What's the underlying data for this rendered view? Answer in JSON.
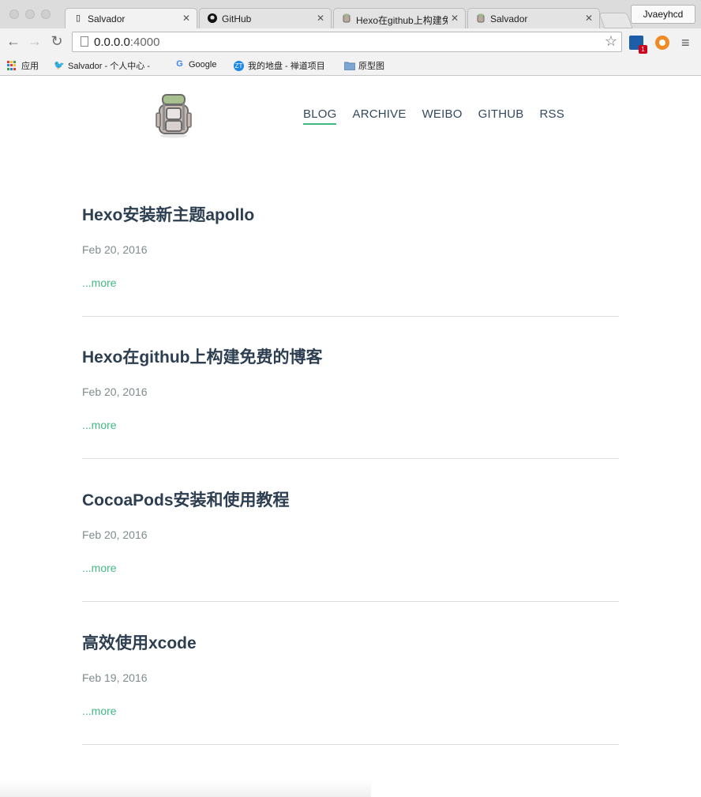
{
  "browser": {
    "tabs": [
      {
        "title": "Salvador",
        "icon": "page-icon",
        "active": true
      },
      {
        "title": "GitHub",
        "icon": "github-icon",
        "active": false
      },
      {
        "title": "Hexo在github上构建免",
        "icon": "backpack-icon",
        "active": false
      },
      {
        "title": "Salvador",
        "icon": "backpack-icon",
        "active": false
      }
    ],
    "profile_name": "Jvaeyhcd",
    "url_host": "0.0.0.0",
    "url_port": ":4000",
    "extension_badge": "1",
    "bookmarks": [
      {
        "label": "应用",
        "icon": "apps-icon"
      },
      {
        "label": "Salvador - 个人中心 -",
        "icon": "bird-icon"
      },
      {
        "label": "Google",
        "icon": "google-icon"
      },
      {
        "label": "我的地盘 - 禅道项目",
        "icon": "zentao-icon"
      },
      {
        "label": "原型图",
        "icon": "folder-icon"
      }
    ]
  },
  "site": {
    "nav": [
      {
        "label": "BLOG",
        "active": true
      },
      {
        "label": "ARCHIVE",
        "active": false
      },
      {
        "label": "WEIBO",
        "active": false
      },
      {
        "label": "GITHUB",
        "active": false
      },
      {
        "label": "RSS",
        "active": false
      }
    ],
    "accent_color": "#42b983",
    "posts": [
      {
        "title": "Hexo安装新主题apollo",
        "date": "Feb 20, 2016",
        "more": "...more"
      },
      {
        "title": "Hexo在github上构建免费的博客",
        "date": "Feb 20, 2016",
        "more": "...more"
      },
      {
        "title": "CocoaPods安装和使用教程",
        "date": "Feb 20, 2016",
        "more": "...more"
      },
      {
        "title": "高效使用xcode",
        "date": "Feb 19, 2016",
        "more": "...more"
      }
    ]
  }
}
